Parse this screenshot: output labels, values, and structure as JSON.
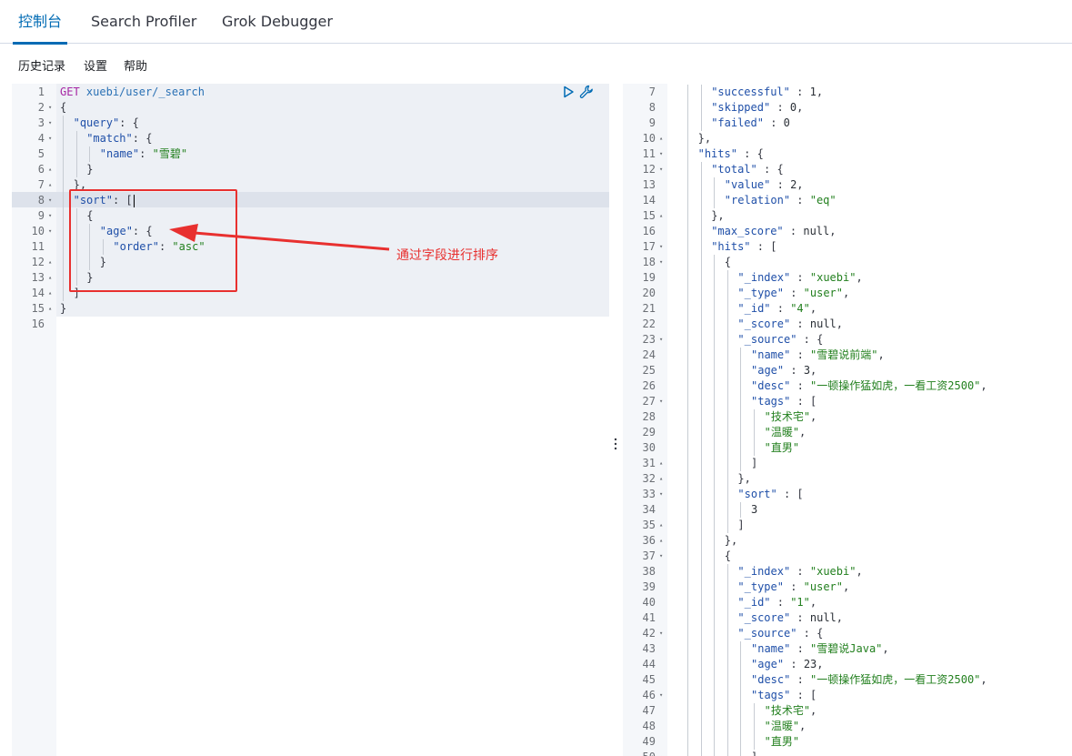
{
  "tabs": [
    {
      "label": "控制台",
      "active": true
    },
    {
      "label": "Search Profiler",
      "active": false
    },
    {
      "label": "Grok Debugger",
      "active": false
    }
  ],
  "menu": [
    "历史记录",
    "设置",
    "帮助"
  ],
  "request": {
    "method": "GET",
    "url": "xuebi/user/_search",
    "active_line": 8,
    "lines": [
      {
        "n": 1,
        "fold": "",
        "indent": 0,
        "tokens": [
          [
            "k",
            "GET"
          ],
          [
            "p",
            " "
          ],
          [
            "u",
            "xuebi/user/_search"
          ]
        ]
      },
      {
        "n": 2,
        "fold": "▾",
        "indent": 0,
        "tokens": [
          [
            "p",
            "{"
          ]
        ]
      },
      {
        "n": 3,
        "fold": "▾",
        "indent": 1,
        "tokens": [
          [
            "key",
            "\"query\""
          ],
          [
            "p",
            ": {"
          ]
        ]
      },
      {
        "n": 4,
        "fold": "▾",
        "indent": 2,
        "tokens": [
          [
            "key",
            "\"match\""
          ],
          [
            "p",
            ": {"
          ]
        ]
      },
      {
        "n": 5,
        "fold": "",
        "indent": 3,
        "tokens": [
          [
            "key",
            "\"name\""
          ],
          [
            "p",
            ": "
          ],
          [
            "str",
            "\"雪碧\""
          ]
        ]
      },
      {
        "n": 6,
        "fold": "▴",
        "indent": 2,
        "tokens": [
          [
            "p",
            "}"
          ]
        ]
      },
      {
        "n": 7,
        "fold": "▴",
        "indent": 1,
        "tokens": [
          [
            "p",
            "},"
          ]
        ]
      },
      {
        "n": 8,
        "fold": "▾",
        "indent": 1,
        "tokens": [
          [
            "key",
            "\"sort\""
          ],
          [
            "p",
            ": ["
          ]
        ]
      },
      {
        "n": 9,
        "fold": "▾",
        "indent": 2,
        "tokens": [
          [
            "p",
            "{"
          ]
        ]
      },
      {
        "n": 10,
        "fold": "▾",
        "indent": 3,
        "tokens": [
          [
            "key",
            "\"age\""
          ],
          [
            "p",
            ": {"
          ]
        ]
      },
      {
        "n": 11,
        "fold": "",
        "indent": 4,
        "tokens": [
          [
            "key",
            "\"order\""
          ],
          [
            "p",
            ": "
          ],
          [
            "str",
            "\"asc\""
          ]
        ]
      },
      {
        "n": 12,
        "fold": "▴",
        "indent": 3,
        "tokens": [
          [
            "p",
            "}"
          ]
        ]
      },
      {
        "n": 13,
        "fold": "▴",
        "indent": 2,
        "tokens": [
          [
            "p",
            "}"
          ]
        ]
      },
      {
        "n": 14,
        "fold": "▴",
        "indent": 1,
        "tokens": [
          [
            "p",
            "]"
          ]
        ]
      },
      {
        "n": 15,
        "fold": "▴",
        "indent": 0,
        "tokens": [
          [
            "p",
            "}"
          ]
        ]
      },
      {
        "n": 16,
        "fold": "",
        "indent": 0,
        "tokens": []
      }
    ]
  },
  "annotation": {
    "text": "通过字段进行排序",
    "color": "#e8302f"
  },
  "response": {
    "lines": [
      {
        "n": 7,
        "fold": "",
        "indent": 2,
        "tokens": [
          [
            "key",
            "\"successful\""
          ],
          [
            "p",
            " : "
          ],
          [
            "num",
            "1"
          ],
          [
            "p",
            ","
          ]
        ]
      },
      {
        "n": 8,
        "fold": "",
        "indent": 2,
        "tokens": [
          [
            "key",
            "\"skipped\""
          ],
          [
            "p",
            " : "
          ],
          [
            "num",
            "0"
          ],
          [
            "p",
            ","
          ]
        ]
      },
      {
        "n": 9,
        "fold": "",
        "indent": 2,
        "tokens": [
          [
            "key",
            "\"failed\""
          ],
          [
            "p",
            " : "
          ],
          [
            "num",
            "0"
          ]
        ]
      },
      {
        "n": 10,
        "fold": "▴",
        "indent": 1,
        "tokens": [
          [
            "p",
            "},"
          ]
        ]
      },
      {
        "n": 11,
        "fold": "▾",
        "indent": 1,
        "tokens": [
          [
            "key",
            "\"hits\""
          ],
          [
            "p",
            " : {"
          ]
        ]
      },
      {
        "n": 12,
        "fold": "▾",
        "indent": 2,
        "tokens": [
          [
            "key",
            "\"total\""
          ],
          [
            "p",
            " : {"
          ]
        ]
      },
      {
        "n": 13,
        "fold": "",
        "indent": 3,
        "tokens": [
          [
            "key",
            "\"value\""
          ],
          [
            "p",
            " : "
          ],
          [
            "num",
            "2"
          ],
          [
            "p",
            ","
          ]
        ]
      },
      {
        "n": 14,
        "fold": "",
        "indent": 3,
        "tokens": [
          [
            "key",
            "\"relation\""
          ],
          [
            "p",
            " : "
          ],
          [
            "str",
            "\"eq\""
          ]
        ]
      },
      {
        "n": 15,
        "fold": "▴",
        "indent": 2,
        "tokens": [
          [
            "p",
            "},"
          ]
        ]
      },
      {
        "n": 16,
        "fold": "",
        "indent": 2,
        "tokens": [
          [
            "key",
            "\"max_score\""
          ],
          [
            "p",
            " : "
          ],
          [
            "num",
            "null"
          ],
          [
            "p",
            ","
          ]
        ]
      },
      {
        "n": 17,
        "fold": "▾",
        "indent": 2,
        "tokens": [
          [
            "key",
            "\"hits\""
          ],
          [
            "p",
            " : ["
          ]
        ]
      },
      {
        "n": 18,
        "fold": "▾",
        "indent": 3,
        "tokens": [
          [
            "p",
            "{"
          ]
        ]
      },
      {
        "n": 19,
        "fold": "",
        "indent": 4,
        "tokens": [
          [
            "key",
            "\"_index\""
          ],
          [
            "p",
            " : "
          ],
          [
            "str",
            "\"xuebi\""
          ],
          [
            "p",
            ","
          ]
        ]
      },
      {
        "n": 20,
        "fold": "",
        "indent": 4,
        "tokens": [
          [
            "key",
            "\"_type\""
          ],
          [
            "p",
            " : "
          ],
          [
            "str",
            "\"user\""
          ],
          [
            "p",
            ","
          ]
        ]
      },
      {
        "n": 21,
        "fold": "",
        "indent": 4,
        "tokens": [
          [
            "key",
            "\"_id\""
          ],
          [
            "p",
            " : "
          ],
          [
            "str",
            "\"4\""
          ],
          [
            "p",
            ","
          ]
        ]
      },
      {
        "n": 22,
        "fold": "",
        "indent": 4,
        "tokens": [
          [
            "key",
            "\"_score\""
          ],
          [
            "p",
            " : "
          ],
          [
            "num",
            "null"
          ],
          [
            "p",
            ","
          ]
        ]
      },
      {
        "n": 23,
        "fold": "▾",
        "indent": 4,
        "tokens": [
          [
            "key",
            "\"_source\""
          ],
          [
            "p",
            " : {"
          ]
        ]
      },
      {
        "n": 24,
        "fold": "",
        "indent": 5,
        "tokens": [
          [
            "key",
            "\"name\""
          ],
          [
            "p",
            " : "
          ],
          [
            "str",
            "\"雪碧说前端\""
          ],
          [
            "p",
            ","
          ]
        ]
      },
      {
        "n": 25,
        "fold": "",
        "indent": 5,
        "tokens": [
          [
            "key",
            "\"age\""
          ],
          [
            "p",
            " : "
          ],
          [
            "num",
            "3"
          ],
          [
            "p",
            ","
          ]
        ]
      },
      {
        "n": 26,
        "fold": "",
        "indent": 5,
        "tokens": [
          [
            "key",
            "\"desc\""
          ],
          [
            "p",
            " : "
          ],
          [
            "str",
            "\"一顿操作猛如虎，一看工资2500\""
          ],
          [
            "p",
            ","
          ]
        ]
      },
      {
        "n": 27,
        "fold": "▾",
        "indent": 5,
        "tokens": [
          [
            "key",
            "\"tags\""
          ],
          [
            "p",
            " : ["
          ]
        ]
      },
      {
        "n": 28,
        "fold": "",
        "indent": 6,
        "tokens": [
          [
            "str",
            "\"技术宅\""
          ],
          [
            "p",
            ","
          ]
        ]
      },
      {
        "n": 29,
        "fold": "",
        "indent": 6,
        "tokens": [
          [
            "str",
            "\"温暖\""
          ],
          [
            "p",
            ","
          ]
        ]
      },
      {
        "n": 30,
        "fold": "",
        "indent": 6,
        "tokens": [
          [
            "str",
            "\"直男\""
          ]
        ]
      },
      {
        "n": 31,
        "fold": "▴",
        "indent": 5,
        "tokens": [
          [
            "p",
            "]"
          ]
        ]
      },
      {
        "n": 32,
        "fold": "▴",
        "indent": 4,
        "tokens": [
          [
            "p",
            "},"
          ]
        ]
      },
      {
        "n": 33,
        "fold": "▾",
        "indent": 4,
        "tokens": [
          [
            "key",
            "\"sort\""
          ],
          [
            "p",
            " : ["
          ]
        ]
      },
      {
        "n": 34,
        "fold": "",
        "indent": 5,
        "tokens": [
          [
            "num",
            "3"
          ]
        ]
      },
      {
        "n": 35,
        "fold": "▴",
        "indent": 4,
        "tokens": [
          [
            "p",
            "]"
          ]
        ]
      },
      {
        "n": 36,
        "fold": "▴",
        "indent": 3,
        "tokens": [
          [
            "p",
            "},"
          ]
        ]
      },
      {
        "n": 37,
        "fold": "▾",
        "indent": 3,
        "tokens": [
          [
            "p",
            "{"
          ]
        ]
      },
      {
        "n": 38,
        "fold": "",
        "indent": 4,
        "tokens": [
          [
            "key",
            "\"_index\""
          ],
          [
            "p",
            " : "
          ],
          [
            "str",
            "\"xuebi\""
          ],
          [
            "p",
            ","
          ]
        ]
      },
      {
        "n": 39,
        "fold": "",
        "indent": 4,
        "tokens": [
          [
            "key",
            "\"_type\""
          ],
          [
            "p",
            " : "
          ],
          [
            "str",
            "\"user\""
          ],
          [
            "p",
            ","
          ]
        ]
      },
      {
        "n": 40,
        "fold": "",
        "indent": 4,
        "tokens": [
          [
            "key",
            "\"_id\""
          ],
          [
            "p",
            " : "
          ],
          [
            "str",
            "\"1\""
          ],
          [
            "p",
            ","
          ]
        ]
      },
      {
        "n": 41,
        "fold": "",
        "indent": 4,
        "tokens": [
          [
            "key",
            "\"_score\""
          ],
          [
            "p",
            " : "
          ],
          [
            "num",
            "null"
          ],
          [
            "p",
            ","
          ]
        ]
      },
      {
        "n": 42,
        "fold": "▾",
        "indent": 4,
        "tokens": [
          [
            "key",
            "\"_source\""
          ],
          [
            "p",
            " : {"
          ]
        ]
      },
      {
        "n": 43,
        "fold": "",
        "indent": 5,
        "tokens": [
          [
            "key",
            "\"name\""
          ],
          [
            "p",
            " : "
          ],
          [
            "str",
            "\"雪碧说Java\""
          ],
          [
            "p",
            ","
          ]
        ]
      },
      {
        "n": 44,
        "fold": "",
        "indent": 5,
        "tokens": [
          [
            "key",
            "\"age\""
          ],
          [
            "p",
            " : "
          ],
          [
            "num",
            "23"
          ],
          [
            "p",
            ","
          ]
        ]
      },
      {
        "n": 45,
        "fold": "",
        "indent": 5,
        "tokens": [
          [
            "key",
            "\"desc\""
          ],
          [
            "p",
            " : "
          ],
          [
            "str",
            "\"一顿操作猛如虎，一看工资2500\""
          ],
          [
            "p",
            ","
          ]
        ]
      },
      {
        "n": 46,
        "fold": "▾",
        "indent": 5,
        "tokens": [
          [
            "key",
            "\"tags\""
          ],
          [
            "p",
            " : ["
          ]
        ]
      },
      {
        "n": 47,
        "fold": "",
        "indent": 6,
        "tokens": [
          [
            "str",
            "\"技术宅\""
          ],
          [
            "p",
            ","
          ]
        ]
      },
      {
        "n": 48,
        "fold": "",
        "indent": 6,
        "tokens": [
          [
            "str",
            "\"温暖\""
          ],
          [
            "p",
            ","
          ]
        ]
      },
      {
        "n": 49,
        "fold": "",
        "indent": 6,
        "tokens": [
          [
            "str",
            "\"直男\""
          ]
        ]
      },
      {
        "n": 50,
        "fold": "▴",
        "indent": 5,
        "tokens": [
          [
            "p",
            "]"
          ]
        ]
      }
    ]
  }
}
